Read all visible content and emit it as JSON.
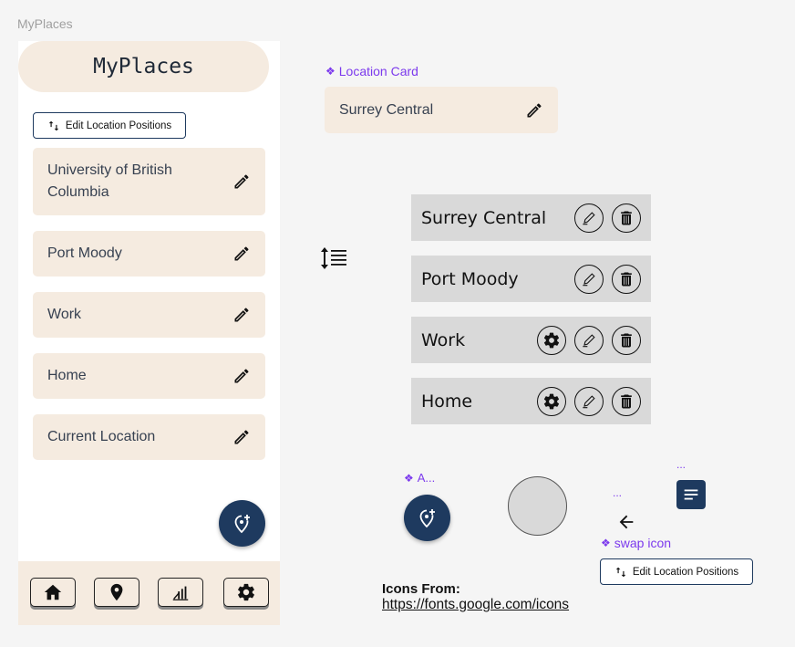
{
  "frame_label": "MyPlaces",
  "app": {
    "title": "MyPlaces",
    "edit_positions_label": "Edit Location Positions",
    "locations": [
      {
        "name": "University of British Columbia"
      },
      {
        "name": "Port Moody"
      },
      {
        "name": "Work"
      },
      {
        "name": "Home"
      },
      {
        "name": "Current Location"
      }
    ],
    "nav": [
      "home-icon",
      "location-pin-icon",
      "leaderboard-icon",
      "settings-icon"
    ]
  },
  "components": {
    "location_card_label": "Location Card",
    "location_card_example": "Surrey Central",
    "edit_rows": [
      {
        "name": "Surrey Central",
        "has_settings": false
      },
      {
        "name": "Port Moody",
        "has_settings": false
      },
      {
        "name": "Work",
        "has_settings": true
      },
      {
        "name": "Home",
        "has_settings": true
      }
    ],
    "add_label": "A...",
    "dots_1": "...",
    "dots_2": "...",
    "swap_icon_label": "swap icon",
    "edit_positions_label": "Edit Location Positions"
  },
  "credits": {
    "label": "Icons From:",
    "url": "https://fonts.google.com/icons"
  },
  "colors": {
    "accent": "#1e3a5f",
    "card_bg": "#f5ebe0",
    "component_purple": "#7c3aed",
    "grey_row": "#d9d9d9"
  }
}
